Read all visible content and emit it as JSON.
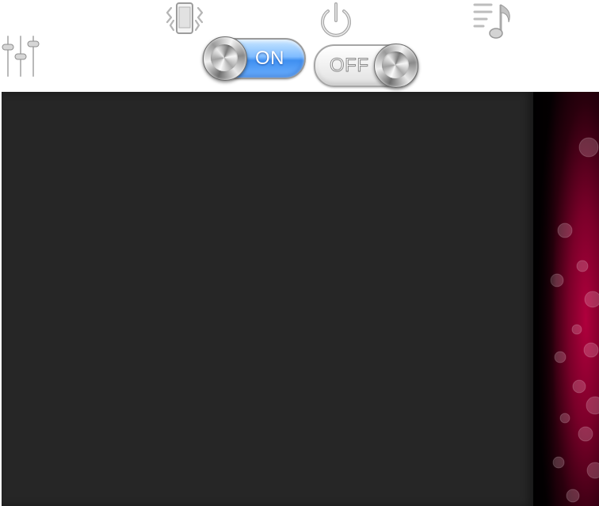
{
  "icons": {
    "equalizer": "equalizer-sliders-icon",
    "vibrate": "vibrate-phone-icon",
    "power": "power-icon",
    "playlist": "music-playlist-icon"
  },
  "toggles": {
    "on": {
      "label": "ON",
      "state": "on",
      "accent": "#4a9af2"
    },
    "off": {
      "label": "OFF",
      "state": "off"
    }
  },
  "panels": {
    "dark_panel_color": "#262626",
    "wallpaper_accent": "#8a0030"
  }
}
